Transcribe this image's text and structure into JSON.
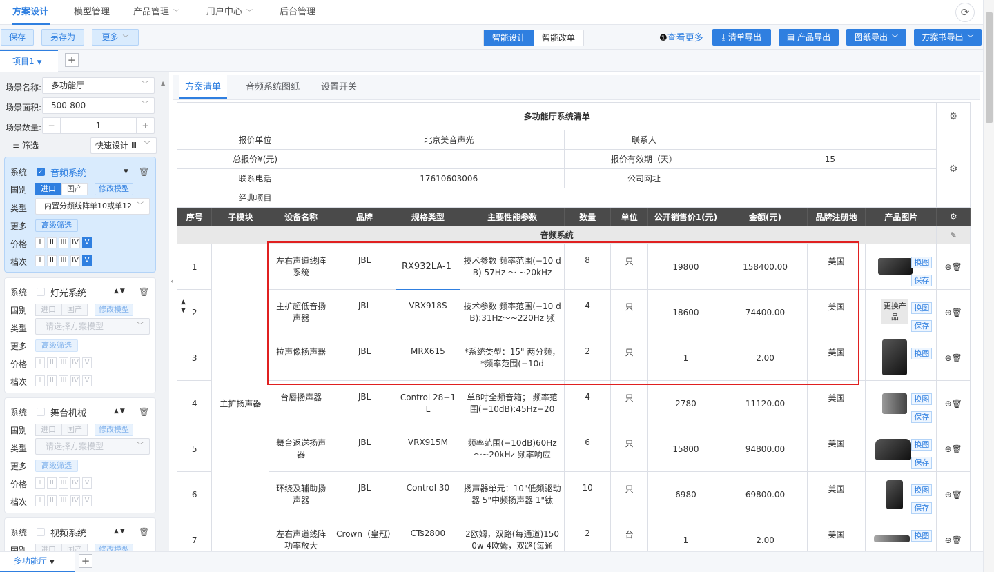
{
  "topnav": {
    "items": [
      "方案设计",
      "模型管理",
      "产品管理",
      "用户中心",
      "后台管理"
    ]
  },
  "toolbar": {
    "save": "保存",
    "save_as": "另存为",
    "more": "更多",
    "seg_smart_design": "智能设计",
    "seg_smart_edit": "智能改单",
    "view_more": "查看更多",
    "export_list": "清单导出",
    "export_product": "产品导出",
    "export_drawing": "图纸导出",
    "export_proposal": "方案书导出"
  },
  "project_tab": "项目1",
  "left": {
    "scene_name_label": "场景名称:",
    "scene_name_value": "多功能厅",
    "scene_area_label": "场景面积:",
    "scene_area_value": "500-800",
    "scene_count_label": "场景数量:",
    "scene_count_value": "1",
    "filter": "筛选",
    "quick_design": "快速设计 Ⅲ",
    "labels": {
      "system": "系统",
      "country": "国别",
      "type": "类型",
      "more": "更多",
      "price": "价格",
      "grade": "档次"
    },
    "import": "进口",
    "domestic": "国产",
    "edit_model": "修改模型",
    "advanced_filter": "高级筛选",
    "levels": [
      "I",
      "II",
      "III",
      "IV",
      "V"
    ],
    "systems": [
      {
        "name": "音频系统",
        "type_value": "内置分频线阵单10或单12"
      },
      {
        "name": "灯光系统",
        "type_value": "请选择方案模型"
      },
      {
        "name": "舞台机械",
        "type_value": "请选择方案模型"
      },
      {
        "name": "视频系统"
      }
    ]
  },
  "bottom_tab": "多功能厅",
  "main_tabs": [
    "方案清单",
    "音频系统图纸",
    "设置开关"
  ],
  "sheet": {
    "title": "多功能厅系统清单",
    "info": {
      "quote_unit_label": "报价单位",
      "quote_unit_value": "北京美音声光",
      "contact_label": "联系人",
      "contact_value": "",
      "total_label": "总报价¥(元)",
      "total_value": "",
      "validity_label": "报价有效期（天）",
      "validity_value": "15",
      "phone_label": "联系电话",
      "phone_value": "17610603006",
      "website_label": "公司网址",
      "website_value": "",
      "project_label": "经典项目",
      "project_value": ""
    },
    "headers": [
      "序号",
      "子模块",
      "设备名称",
      "品牌",
      "规格类型",
      "主要性能参数",
      "数量",
      "单位",
      "公开销售价1(元)",
      "金额(元)",
      "品牌注册地",
      "产品图片"
    ],
    "group": "音频系统",
    "submodule": "主扩扬声器",
    "swap": "换图",
    "save": "保存",
    "change_product": "更换产品",
    "rows": [
      {
        "no": "1",
        "name": "左右声道线阵系统",
        "brand": "JBL",
        "model": "RX932LA-1",
        "params": "技术参数 频率范围(−10 dB) 57Hz ～ ~20kHz",
        "qty": "8",
        "unit": "只",
        "price": "19800",
        "amount": "158400.00",
        "origin": "美国"
      },
      {
        "no": "2",
        "name": "主扩超低音扬声器",
        "brand": "JBL",
        "model": "VRX918S",
        "params": "技术参数 频率范围(−10 dB):31Hz～~220Hz 频",
        "qty": "4",
        "unit": "只",
        "price": "18600",
        "amount": "74400.00",
        "origin": "美国"
      },
      {
        "no": "3",
        "name": "拉声像扬声器",
        "brand": "JBL",
        "model": "MRX615",
        "params": "*系统类型：15\" 两分频， *频率范围(−10d",
        "qty": "2",
        "unit": "只",
        "price": "1",
        "amount": "2.00",
        "origin": "美国"
      },
      {
        "no": "4",
        "name": "台唇扬声器",
        "brand": "JBL",
        "model": "Control 28−1L",
        "params": "单8吋全频音箱； 频率范围(−10dB):45Hz−20",
        "qty": "4",
        "unit": "只",
        "price": "2780",
        "amount": "11120.00",
        "origin": "美国"
      },
      {
        "no": "5",
        "name": "舞台返送扬声器",
        "brand": "JBL",
        "model": "VRX915M",
        "params": "频率范围(−10dB)60Hz ～~20kHz 频率响应",
        "qty": "6",
        "unit": "只",
        "price": "15800",
        "amount": "94800.00",
        "origin": "美国"
      },
      {
        "no": "6",
        "name": "环绕及辅助扬声器",
        "brand": "JBL",
        "model": "Control 30",
        "params": "扬声器单元：10\"低频驱动器 5\"中频扬声器 1\"钛",
        "qty": "10",
        "unit": "只",
        "price": "6980",
        "amount": "69800.00",
        "origin": "美国"
      },
      {
        "no": "7",
        "name": "左右声道线阵功率放大",
        "brand": "Crown（皇冠）",
        "model": "CTs2800",
        "params": "2欧姆，双路(每通道)1500w 4欧姆，双路(每通",
        "qty": "2",
        "unit": "台",
        "price": "1",
        "amount": "2.00",
        "origin": "美国"
      }
    ]
  }
}
